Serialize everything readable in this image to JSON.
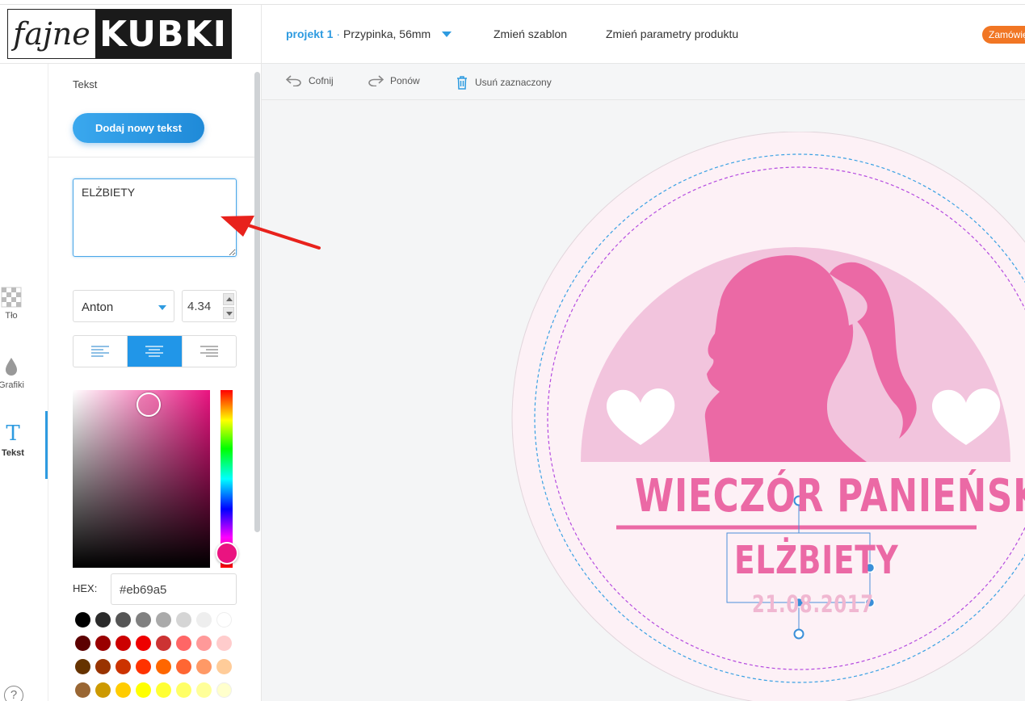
{
  "logo": {
    "left_text": "fajne",
    "right_text": "KUBKI"
  },
  "header": {
    "project_name": "projekt 1",
    "separator": "·",
    "product": "Przypinka, 56mm",
    "change_template": "Zmień szablon",
    "change_params": "Zmień parametry produktu",
    "order": "Zamówię"
  },
  "toolbar": {
    "undo": "Cofnij",
    "redo": "Ponów",
    "delete": "Usuń zaznaczony"
  },
  "rail": {
    "background": "Tło",
    "graphics": "Grafiki",
    "text": "Tekst",
    "text_glyph": "T",
    "help": "?"
  },
  "panel": {
    "title": "Tekst",
    "add_button": "Dodaj nowy tekst",
    "text_value": "ELŻBIETY",
    "font": "Anton",
    "size": "4.34",
    "alignment": "center",
    "hex_label": "HEX:",
    "hex_value": "#eb69a5",
    "swatches": [
      [
        "#000000",
        "#2b2b2b",
        "#555555",
        "#808080",
        "#aaaaaa",
        "#d5d5d5",
        "#eeeeee",
        "#ffffff"
      ],
      [
        "#5c0000",
        "#990000",
        "#cc0000",
        "#ee0000",
        "#cc3333",
        "#ff6666",
        "#ff9999",
        "#ffcccc"
      ],
      [
        "#663300",
        "#993300",
        "#cc3300",
        "#ff3300",
        "#ff6600",
        "#ff6633",
        "#ff9966",
        "#ffcc99"
      ],
      [
        "#996633",
        "#cc9900",
        "#ffcc00",
        "#ffff00",
        "#ffff33",
        "#ffff66",
        "#ffff99",
        "#ffffcc"
      ]
    ]
  },
  "design": {
    "title": "WIECZÓR PANIEŃSKI",
    "name": "ELŻBIETY",
    "date": "21.08.2017",
    "colors": {
      "primary": "#eb69a5",
      "light": "#f2c4dd",
      "bg": "#fdf1f6",
      "date": "#f0b7d1"
    }
  },
  "colors": {
    "accent": "#2e9be0",
    "order": "#f17624"
  }
}
